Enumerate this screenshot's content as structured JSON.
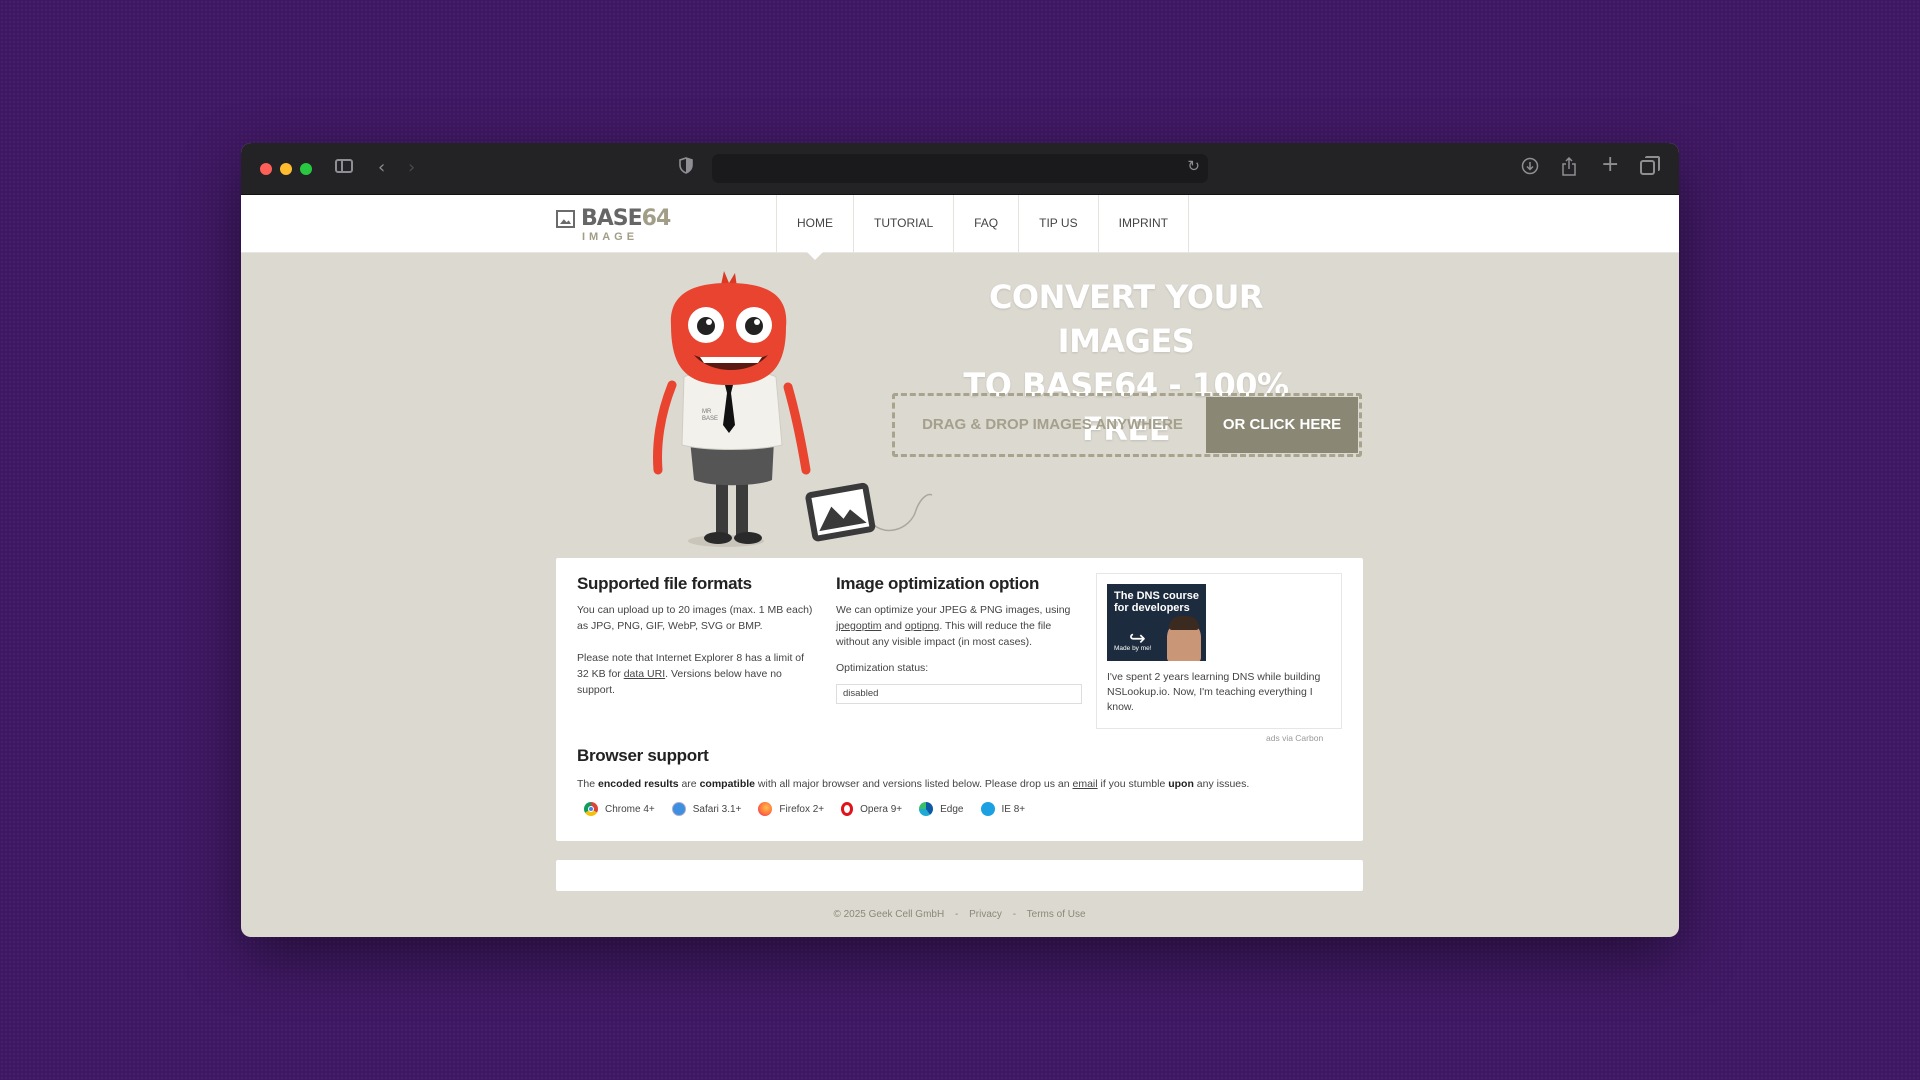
{
  "header": {
    "logo_main": "BASE",
    "logo_num": "64",
    "logo_sub": "IMAGE",
    "nav": [
      "HOME",
      "TUTORIAL",
      "FAQ",
      "TIP US",
      "IMPRINT"
    ]
  },
  "mascot": {
    "shirt_text_1": "MR",
    "shirt_text_2": "BASE"
  },
  "hero": {
    "title_line1": "CONVERT YOUR IMAGES",
    "title_line2": "TO BASE64 - 100% FREE",
    "drop_label": "DRAG & DROP IMAGES ANYWHERE",
    "click_label": "OR CLICK HERE"
  },
  "formats": {
    "title": "Supported file formats",
    "p1": "You can upload up to 20 images (max. 1 MB each) as JPG, PNG, GIF, WebP, SVG or BMP.",
    "p2_a": "Please note that Internet Explorer 8 has a limit of 32 KB for ",
    "p2_link": "data URI",
    "p2_b": ". Versions below have no support."
  },
  "optimization": {
    "title": "Image optimization option",
    "p_a": "We can optimize your JPEG & PNG images, using ",
    "link1": "jpegoptim",
    "p_and": " and ",
    "link2": "optipng",
    "p_b": ". This will reduce the file without any visible impact (in most cases).",
    "status_label": "Optimization status:",
    "status_value": "disabled"
  },
  "ad": {
    "img_title": "The DNS course for developers",
    "img_made": "Made by me!",
    "text": "I've spent 2 years learning DNS while building NSLookup.io. Now, I'm teaching everything I know.",
    "via": "ads via Carbon"
  },
  "browser_support": {
    "title": "Browser support",
    "t1": "The ",
    "b1": "encoded results",
    "t2": " are ",
    "b2": "compatible",
    "t3": " with all major browser and versions listed below. Please drop us an ",
    "link": "email",
    "t4": " if you stumble ",
    "b3": "upon",
    "t5": " any issues.",
    "browsers": [
      "Chrome 4+",
      "Safari 3.1+",
      "Firefox 2+",
      "Opera 9+",
      "Edge",
      "IE 8+"
    ]
  },
  "footer": {
    "copyright": "© 2025 Geek Cell GmbH",
    "sep": "-",
    "privacy": "Privacy",
    "terms": "Terms of Use"
  },
  "colors": {
    "desktop_bg": "#3f1863",
    "page_bg": "#dcd9d0",
    "accent": "#8a8875",
    "mascot_red": "#e8442f"
  }
}
